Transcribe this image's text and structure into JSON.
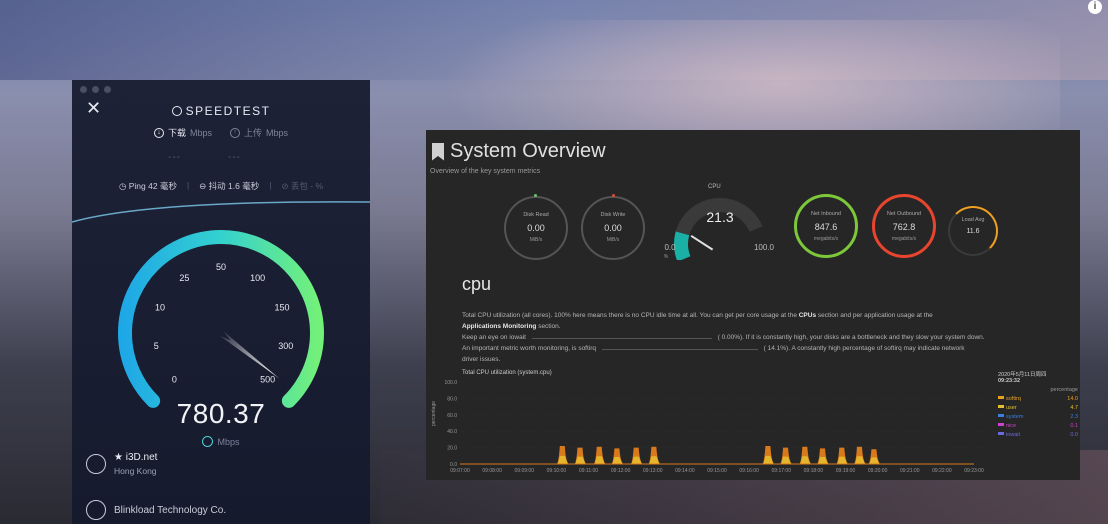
{
  "speedtest": {
    "title": "SPEEDTEST",
    "tabs": [
      {
        "label": "下载",
        "unit": "Mbps",
        "active": true
      },
      {
        "label": "上传",
        "unit": "Mbps",
        "active": false
      }
    ],
    "dashes": [
      "---",
      "---"
    ],
    "info": {
      "ping": "Ping 42 毫秒",
      "jitter": "抖动 1.6 毫秒",
      "loss": "丢包 - %"
    },
    "gauge": {
      "ticks": [
        "0",
        "5",
        "10",
        "25",
        "50",
        "100",
        "150",
        "300",
        "500"
      ],
      "value_mbps": 780.37,
      "max_mbps": 500
    },
    "speed": "780.37",
    "unit": "Mbps",
    "server": {
      "name": "★ i3D.net",
      "location": "Hong Kong"
    },
    "isp": "Blinkload Technology Co.",
    "colors": {
      "gauge_start": "#1fb6e6",
      "gauge_end": "#6ef07d",
      "accent": "#4fd0d9"
    }
  },
  "overview": {
    "title": "System Overview",
    "subtitle": "Overview of the key system metrics",
    "gauges": [
      {
        "label": "Disk Read",
        "value": "0.00",
        "unit": "MiB/s",
        "color": "#5a5a5a",
        "dot": "#6ac26a"
      },
      {
        "label": "Disk Write",
        "value": "0.00",
        "unit": "MiB/s",
        "color": "#5a5a5a",
        "dot": "#e04a3a"
      },
      {
        "label": "Net Inbound",
        "value": "847.6",
        "unit": "megabits/s",
        "color": "#7cc83a",
        "dot": null
      },
      {
        "label": "Net Outbound",
        "value": "762.8",
        "unit": "megabits/s",
        "color": "#e8452f",
        "dot": null
      },
      {
        "label": "Load Avg",
        "value": "11.6",
        "unit": "",
        "color": "#f0a020",
        "dot": null
      }
    ],
    "cpu_gauge": {
      "label": "CPU",
      "value": "21.3",
      "min": "0.0",
      "max": "100.0",
      "unit": "%",
      "percent": 21.3,
      "color": "#1ab0a6"
    },
    "section": "cpu",
    "para1_a": "Total CPU utilization (all cores). 100% here means there is no CPU idle time at all. You can get per core usage at the ",
    "para1_b": "CPUs",
    "para1_c": " section and per application usage at the",
    "para2_a": "Applications Monitoring",
    "para2_b": " section.",
    "para3": "Keep an eye on iowait",
    "para3_b": "( 0.00%). If it is constantly high, your disks are a bottleneck and they slow your system down.",
    "para4": "An important metric worth monitoring, is softirq",
    "para4_b": "( 14.1%). A constantly high percentage of softirq may indicate network",
    "para5": "driver issues.",
    "chart_title": "Total CPU utilization (system.cpu)",
    "chart_date": "2020年5月11日周四",
    "chart_time": "09:23:32",
    "legend": [
      {
        "name": "softirq",
        "value": "14.0",
        "color": "#e8a020"
      },
      {
        "name": "user",
        "value": "4.7",
        "color": "#e0c030"
      },
      {
        "name": "system",
        "value": "2.3",
        "color": "#3a7ee0"
      },
      {
        "name": "nice",
        "value": "0.1",
        "color": "#d040d0"
      },
      {
        "name": "iowait",
        "value": "0.0",
        "color": "#6a6ae0"
      }
    ],
    "legend_header": "percentage",
    "chart_data": {
      "type": "area",
      "ylabel": "percentage",
      "y_ticks": [
        "100.0",
        "80.0",
        "60.0",
        "40.0",
        "20.0",
        "0.0"
      ],
      "x_ticks": [
        "09:07:00",
        "09:08:00",
        "09:09:00",
        "09:10:00",
        "09:11:00",
        "09:12:00",
        "09:13:00",
        "09:14:00",
        "09:15:00",
        "09:16:00",
        "09:17:00",
        "09:18:00",
        "09:19:00",
        "09:20:00",
        "09:21:00",
        "09:22:00",
        "09:23:00"
      ],
      "ylim": [
        0,
        100
      ],
      "bursts": [
        {
          "t": 6.4,
          "v": 22
        },
        {
          "t": 7.5,
          "v": 20
        },
        {
          "t": 8.7,
          "v": 21
        },
        {
          "t": 9.8,
          "v": 19
        },
        {
          "t": 11.0,
          "v": 20
        },
        {
          "t": 12.1,
          "v": 21
        },
        {
          "t": 19.2,
          "v": 22
        },
        {
          "t": 20.3,
          "v": 20
        },
        {
          "t": 21.5,
          "v": 21
        },
        {
          "t": 22.6,
          "v": 19
        },
        {
          "t": 23.8,
          "v": 20
        },
        {
          "t": 24.9,
          "v": 21
        },
        {
          "t": 25.8,
          "v": 18
        }
      ]
    }
  }
}
